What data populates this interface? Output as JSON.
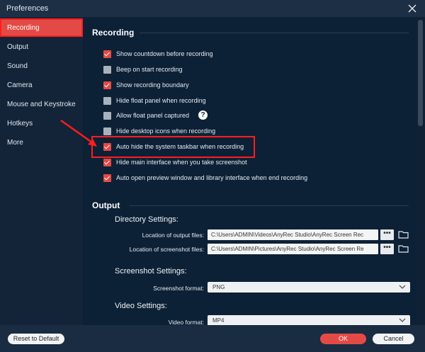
{
  "window": {
    "title": "Preferences"
  },
  "sidebar": {
    "items": [
      {
        "label": "Recording",
        "active": true
      },
      {
        "label": "Output"
      },
      {
        "label": "Sound"
      },
      {
        "label": "Camera"
      },
      {
        "label": "Mouse and Keystroke"
      },
      {
        "label": "Hotkeys"
      },
      {
        "label": "More"
      }
    ]
  },
  "recording": {
    "title": "Recording",
    "options": [
      {
        "label": "Show countdown before recording",
        "checked": true
      },
      {
        "label": "Beep on start recording",
        "checked": false
      },
      {
        "label": "Show recording boundary",
        "checked": true
      },
      {
        "label": "Hide float panel when recording",
        "checked": false
      },
      {
        "label": "Allow float panel captured",
        "checked": false
      },
      {
        "label": "Hide desktop icons when recording",
        "checked": false
      },
      {
        "label": "Auto hide the system taskbar when recording",
        "checked": true
      },
      {
        "label": "Hide main interface when you take screenshot",
        "checked": true
      },
      {
        "label": "Auto open preview window and library interface when end recording",
        "checked": true
      }
    ],
    "help_glyph": "?"
  },
  "output": {
    "title": "Output",
    "directory": {
      "title": "Directory Settings:",
      "output_label": "Location of output files:",
      "output_value": "C:\\Users\\ADMIN\\Videos\\AnyRec Studio\\AnyRec Screen Rec",
      "screenshot_label": "Location of screenshot files:",
      "screenshot_value": "C:\\Users\\ADMIN\\Pictures\\AnyRec Studio\\AnyRec Screen Re",
      "dots": "•••"
    },
    "screenshot": {
      "title": "Screenshot Settings:",
      "format_label": "Screenshot format:",
      "format_value": "PNG"
    },
    "video": {
      "title": "Video Settings:",
      "format_label": "Video format:",
      "format_value": "MP4"
    }
  },
  "footer": {
    "reset": "Reset to Default",
    "ok": "OK",
    "cancel": "Cancel"
  },
  "colors": {
    "accent": "#e44a45",
    "panel": "#0d2136",
    "sidebar": "#142438"
  }
}
